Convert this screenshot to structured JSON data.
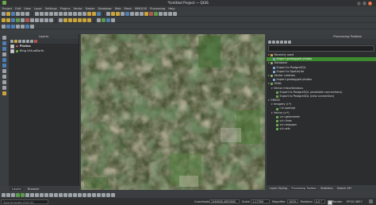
{
  "window": {
    "title": "*Untitled Project — QGIS"
  },
  "menubar": [
    "Project",
    "Edit",
    "View",
    "Layer",
    "Settings",
    "Plugins",
    "Vector",
    "Raster",
    "Database",
    "Web",
    "Mesh",
    "MMQGIS",
    "Processing",
    "Help"
  ],
  "layers_panel": {
    "title": "Layers",
    "items": [
      {
        "label": "Photos",
        "checked": true,
        "type": "vector-points"
      },
      {
        "label": "Bing VirtualEarth",
        "checked": true,
        "type": "raster-xyz"
      }
    ]
  },
  "left_tabs": [
    "Layers",
    "Browser"
  ],
  "toolbox": {
    "title": "Processing Toolbox",
    "tree": [
      {
        "label": "Recently used",
        "level": 0,
        "icon": "clock-icon"
      },
      {
        "label": "Import geotagged photos",
        "level": 1,
        "icon": "gear-icon",
        "selected": true
      },
      {
        "label": "Database",
        "level": 0,
        "icon": "database-icon"
      },
      {
        "label": "Export to PostgreSQL",
        "level": 1,
        "icon": "gear-icon"
      },
      {
        "label": "Export to SpatiaLite",
        "level": 1,
        "icon": "gear-icon"
      },
      {
        "label": "Vector creation",
        "level": 0,
        "icon": "vector-icon"
      },
      {
        "label": "Import geotagged photos",
        "level": 1,
        "icon": "gear-icon"
      },
      {
        "label": "GDAL",
        "level": 0,
        "icon": "gdal-icon"
      },
      {
        "label": "Vector miscellaneous",
        "level": 1,
        "icon": "folder-icon"
      },
      {
        "label": "Export to PostgreSQL (available connections)",
        "level": 2,
        "icon": "gear-icon"
      },
      {
        "label": "Export to PostgreSQL (new connection)",
        "level": 2,
        "icon": "gear-icon"
      },
      {
        "label": "GRASS",
        "level": 0,
        "icon": "grass-icon"
      },
      {
        "label": "Imagery (i.*)",
        "level": 1,
        "icon": "folder-icon"
      },
      {
        "label": "i.in.spotvgt",
        "level": 2,
        "icon": "gear-icon"
      },
      {
        "label": "Vector (v.*)",
        "level": 1,
        "icon": "folder-icon"
      },
      {
        "label": "v.in.geonames",
        "level": 2,
        "icon": "gear-icon"
      },
      {
        "label": "v.in.lines",
        "level": 2,
        "icon": "gear-icon"
      },
      {
        "label": "v.in.mapgen",
        "level": 2,
        "icon": "gear-icon"
      },
      {
        "label": "v.in.wfs",
        "level": 2,
        "icon": "gear-icon"
      }
    ]
  },
  "right_tabs": [
    {
      "label": "Layer Styling",
      "active": false
    },
    {
      "label": "Processing Toolbox",
      "active": true
    },
    {
      "label": "Statistics",
      "active": false
    },
    {
      "label": "Search API",
      "active": false
    }
  ],
  "statusbar": {
    "search_placeholder": "Type to locate (Ctrl+K)",
    "coordinate_label": "Coordinate",
    "coordinate_value": "1346000,4853000",
    "scale_label": "Scale",
    "scale_value": "1:17359",
    "magnifier_label": "Magnifier",
    "magnifier_value": "100%",
    "rotation_label": "Rotation",
    "rotation_value": "0.0 °",
    "render_label": "Render",
    "crs_label": "EPSG:3857"
  },
  "colors": {
    "selected_row": "#3e8a2f",
    "panel_bg": "#2b2d2f",
    "chrome_bg": "#3b3e40"
  }
}
